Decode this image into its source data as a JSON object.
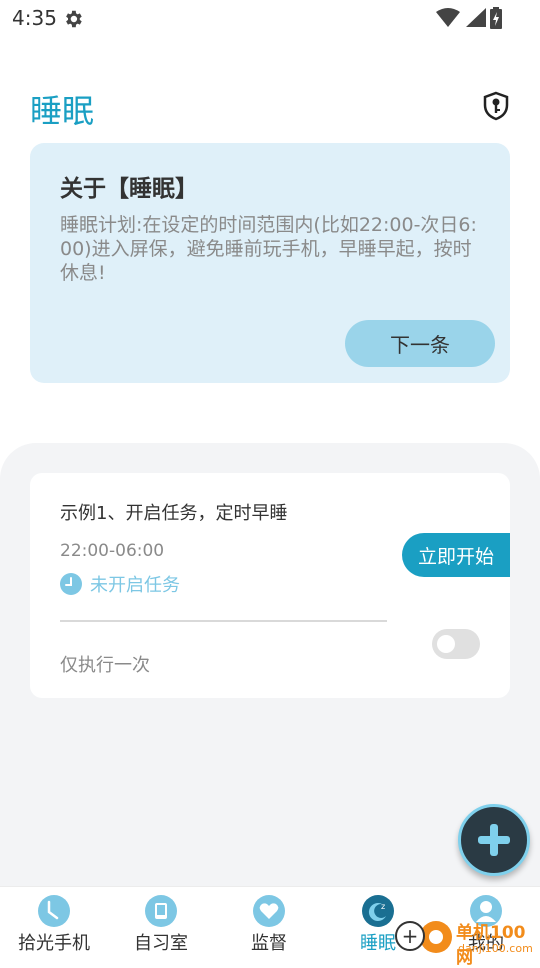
{
  "status_bar": {
    "time": "4:35",
    "icons": [
      "gear-icon",
      "wifi-icon",
      "signal-icon",
      "battery-icon"
    ]
  },
  "header": {
    "title": "睡眠",
    "icon": "shield-key-icon"
  },
  "info_card": {
    "title": "关于【睡眠】",
    "description": "睡眠计划:在设定的时间范围内(比如22:00-次日6:00)进入屏保，避免睡前玩手机，早睡早起，按时休息!",
    "next_button": "下一条"
  },
  "task": {
    "title": "示例1、开启任务，定时早睡",
    "time_range": "22:00-06:00",
    "status": "未开启任务",
    "start_button": "立即开始",
    "repeat": "仅执行一次",
    "enabled": false
  },
  "fab": {
    "icon": "plus-icon"
  },
  "bottom_nav": {
    "items": [
      {
        "label": "拾光手机",
        "icon": "clock-icon",
        "active": false
      },
      {
        "label": "自习室",
        "icon": "book-icon",
        "active": false
      },
      {
        "label": "监督",
        "icon": "heart-icon",
        "active": false
      },
      {
        "label": "睡眠",
        "icon": "moon-icon",
        "active": true
      },
      {
        "label": "我的",
        "icon": "person-icon",
        "active": false
      }
    ]
  },
  "watermark": {
    "text": "单机100网",
    "url": "danji100.com"
  },
  "colors": {
    "accent": "#1a9fc3",
    "card_bg": "#dff0f9",
    "button_light": "#9ad4ea",
    "watermark": "#f28c1b"
  }
}
